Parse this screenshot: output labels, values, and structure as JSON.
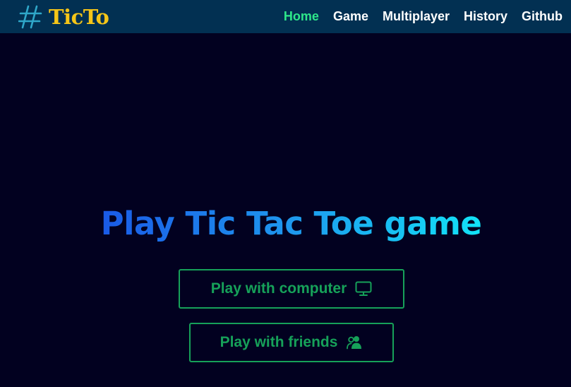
{
  "colors": {
    "background": "#020120",
    "navbar": "#023052",
    "brand": "#f5c518",
    "active_link": "#2ee68a",
    "button": "#16a159"
  },
  "brand": {
    "icon": "hash-icon",
    "name": "TicTo"
  },
  "nav": {
    "items": [
      {
        "label": "Home",
        "active": true
      },
      {
        "label": "Game",
        "active": false
      },
      {
        "label": "Multiplayer",
        "active": false
      },
      {
        "label": "History",
        "active": false
      },
      {
        "label": "Github",
        "active": false
      }
    ]
  },
  "main": {
    "title": "Play Tic Tac Toe game",
    "buttons": [
      {
        "label": "Play with computer",
        "icon": "monitor-icon"
      },
      {
        "label": "Play with friends",
        "icon": "users-icon"
      }
    ]
  }
}
